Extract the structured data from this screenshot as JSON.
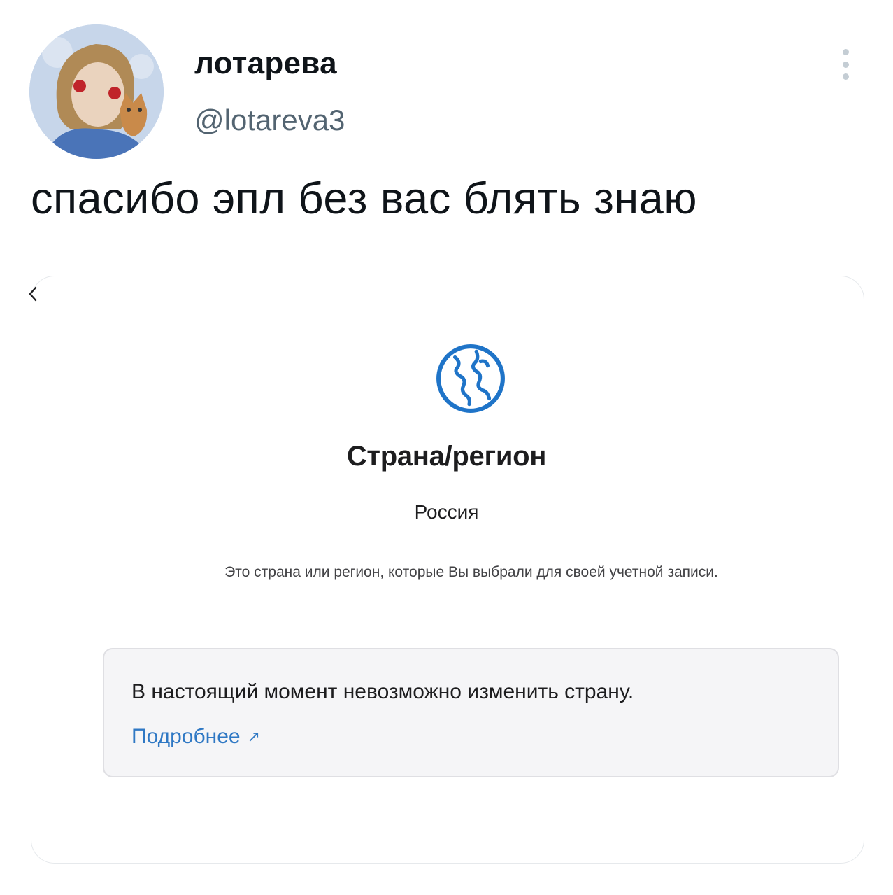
{
  "author": {
    "display_name": "лотарева",
    "handle": "@lotareva3",
    "avatar_icon": "avatar-illustration"
  },
  "tweet": {
    "text": "спасибо эпл без вас блять знаю"
  },
  "more_icon": "more-vertical-icon",
  "screenshot": {
    "back_icon": "chevron-left-icon",
    "globe_icon": "globe-icon",
    "title": "Страна/регион",
    "country": "Россия",
    "description": "Это страна или регион, которые Вы выбрали для своей учетной записи.",
    "notice": {
      "text": "В настоящий момент невозможно изменить страну.",
      "link_label": "Подробнее",
      "link_arrow": "↗"
    }
  },
  "colors": {
    "link": "#2f78c4",
    "globe": "#1f74c8",
    "handle": "#536471"
  }
}
